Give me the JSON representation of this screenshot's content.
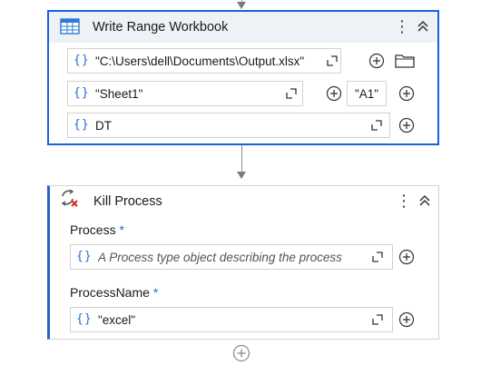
{
  "write_range": {
    "title": "Write Range Workbook",
    "icon": "spreadsheet-icon",
    "path_value": "\"C:\\Users\\dell\\Documents\\Output.xlsx\"",
    "sheet_value": "\"Sheet1\"",
    "cell_value": "\"A1\"",
    "datatable_value": "DT",
    "brace_symbol": "{}"
  },
  "kill_process": {
    "title": "Kill Process",
    "icon": "kill-process-icon",
    "process_label": "Process",
    "process_placeholder": "A Process type object describing the process",
    "processname_label": "ProcessName",
    "processname_value": "\"excel\"",
    "required_mark": "*",
    "brace_symbol": "{}"
  },
  "colors": {
    "accent": "#1565d8",
    "brace": "#1f6fd1",
    "header_bg": "#eef1f5",
    "connector": "#8a8a8a"
  }
}
